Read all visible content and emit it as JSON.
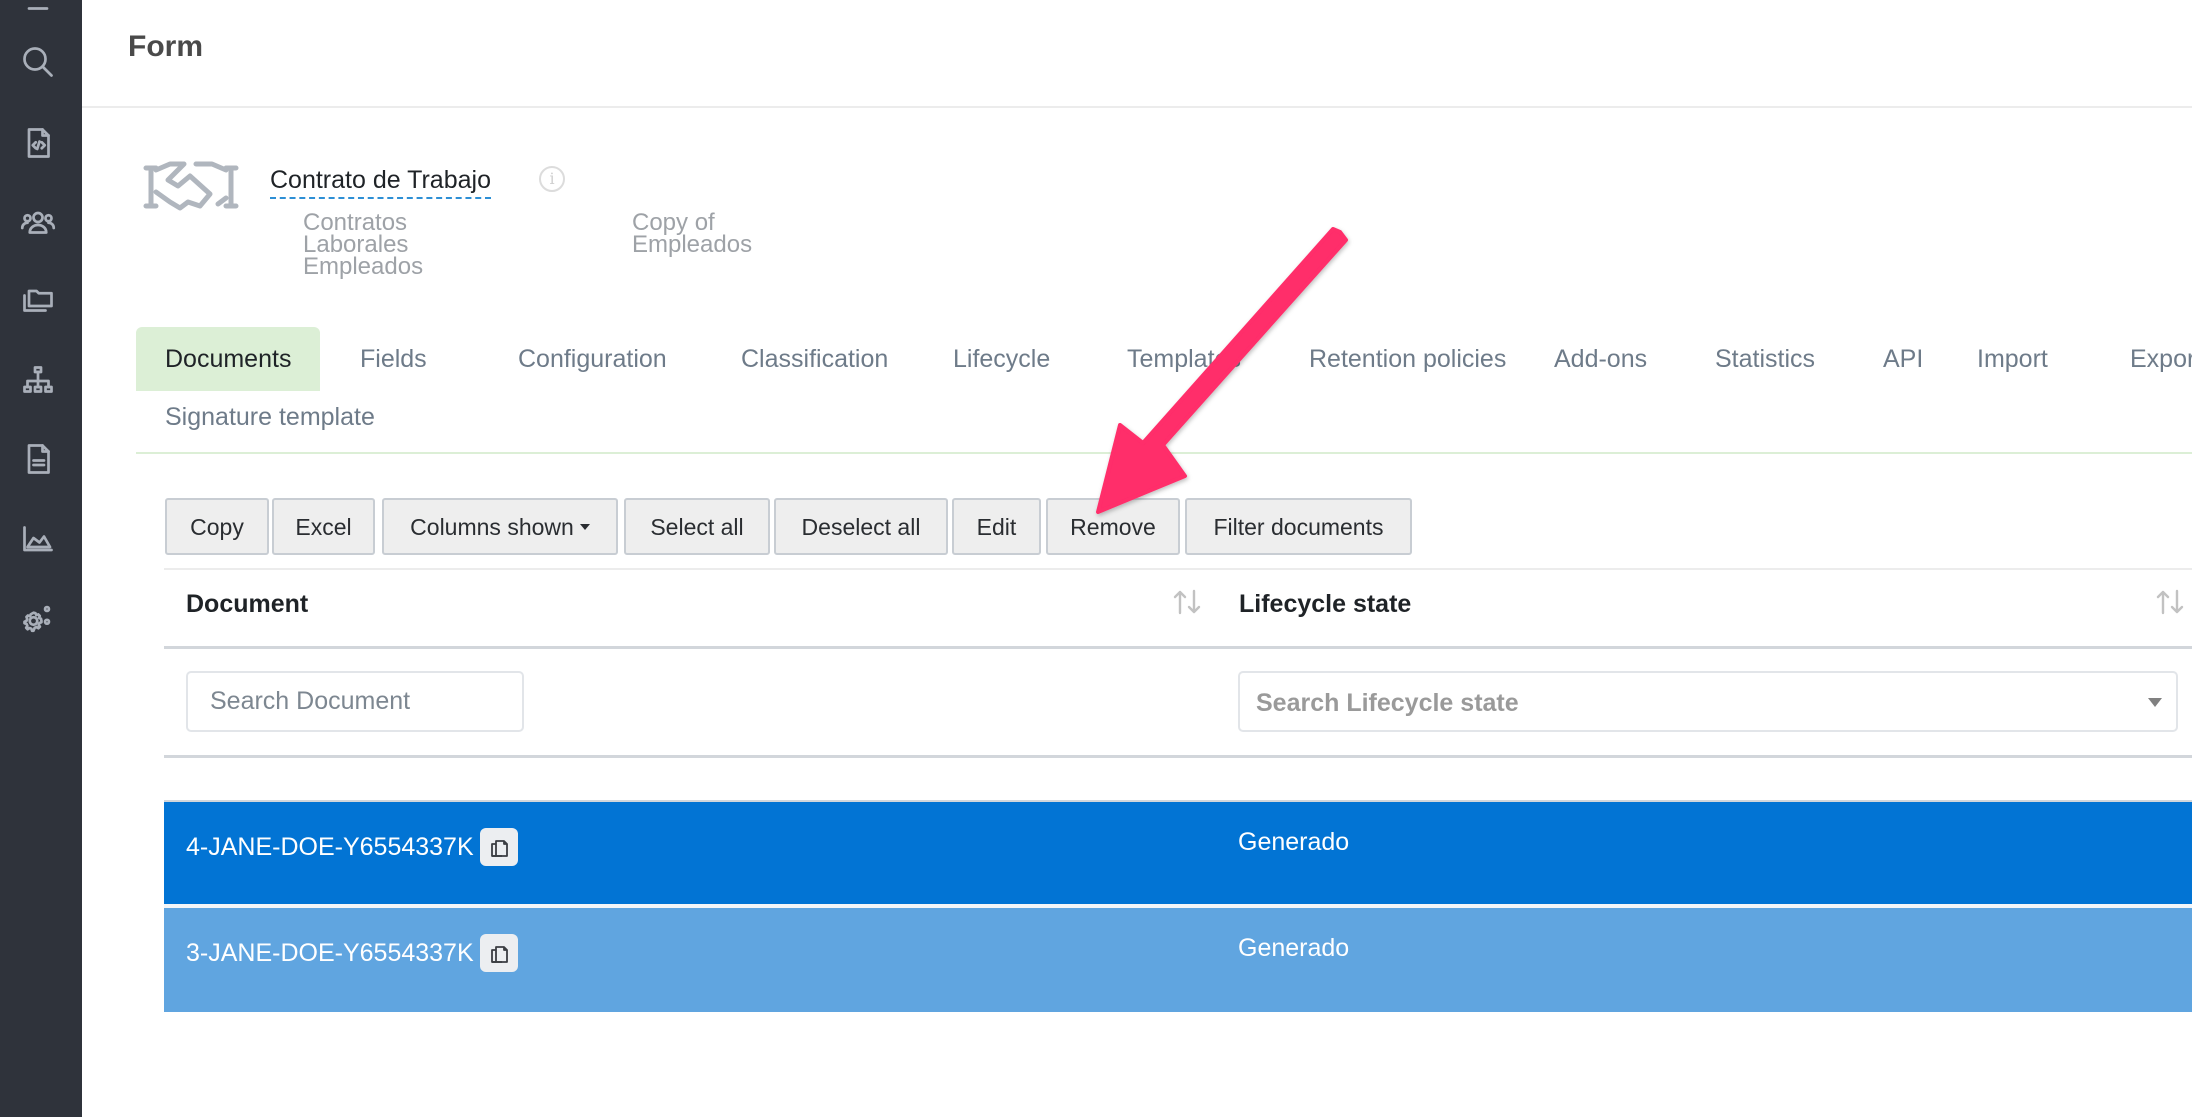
{
  "sidebar": {
    "items": [
      {
        "icon": "search-icon"
      },
      {
        "icon": "code-file-icon"
      },
      {
        "icon": "users-icon"
      },
      {
        "icon": "folders-icon"
      },
      {
        "icon": "sitemap-icon"
      },
      {
        "icon": "document-icon"
      },
      {
        "icon": "area-chart-icon"
      },
      {
        "icon": "settings-gears-icon"
      }
    ]
  },
  "header": {
    "title": "Form"
  },
  "form": {
    "icon": "handshake-icon",
    "name": "Contrato de Trabajo",
    "info_icon": "info-icon",
    "categories": [
      [
        "Contratos",
        "Laborales",
        "Empleados"
      ],
      [
        "Copy of",
        "Empleados"
      ]
    ]
  },
  "tabs": [
    {
      "label": "Documents",
      "active": true
    },
    {
      "label": "Fields"
    },
    {
      "label": "Configuration"
    },
    {
      "label": "Classification"
    },
    {
      "label": "Lifecycle"
    },
    {
      "label": "Templates"
    },
    {
      "label": "Retention policies"
    },
    {
      "label": "Add-ons"
    },
    {
      "label": "Statistics"
    },
    {
      "label": "API"
    },
    {
      "label": "Import"
    },
    {
      "label": "Export"
    },
    {
      "label": "Signature template"
    }
  ],
  "toolbar": {
    "buttons": [
      {
        "label": "Copy"
      },
      {
        "label": "Excel"
      },
      {
        "label": "Columns shown",
        "dropdown": true
      },
      {
        "label": "Select all"
      },
      {
        "label": "Deselect all"
      },
      {
        "label": "Edit"
      },
      {
        "label": "Remove"
      },
      {
        "label": "Filter documents"
      }
    ]
  },
  "table": {
    "columns": [
      {
        "label": "Document",
        "filter_placeholder": "Search Document"
      },
      {
        "label": "Lifecycle state",
        "filter_placeholder": "Search Lifecycle state"
      }
    ],
    "rows": [
      {
        "document": "4-JANE-DOE-Y6554337K",
        "state": "Generado",
        "selected": true
      },
      {
        "document": "3-JANE-DOE-Y6554337K",
        "state": "Generado",
        "selected": true
      }
    ]
  },
  "colors": {
    "sidebar_bg": "#2f333b",
    "active_tab_bg": "#dcefd6",
    "row_selected_primary": "#0274d4",
    "row_selected_secondary": "#60a5e0",
    "annotation_arrow": "#ff2d6a"
  },
  "annotation": {
    "type": "arrow",
    "points_to": "Remove"
  }
}
